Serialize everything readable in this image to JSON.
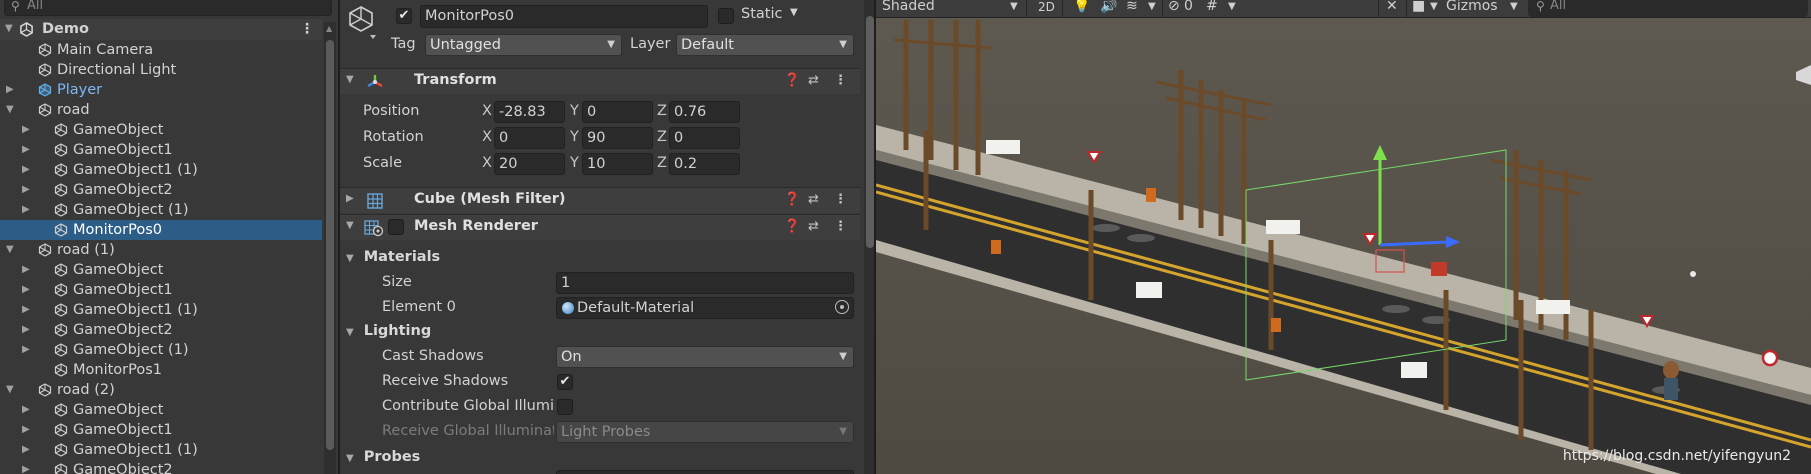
{
  "hierarchy": {
    "search_placeholder": "All",
    "scene_name": "Demo",
    "rows": [
      {
        "label": "Main Camera",
        "indent": 1,
        "arrow": false,
        "kind": "cube"
      },
      {
        "label": "Directional Light",
        "indent": 1,
        "arrow": false,
        "kind": "cube"
      },
      {
        "label": "Player",
        "indent": 1,
        "arrow": true,
        "kind": "prefab"
      },
      {
        "label": "road",
        "indent": 1,
        "arrow": "open",
        "kind": "cube"
      },
      {
        "label": "GameObject",
        "indent": 2,
        "arrow": true,
        "kind": "cube"
      },
      {
        "label": "GameObject1",
        "indent": 2,
        "arrow": true,
        "kind": "cube"
      },
      {
        "label": "GameObject1 (1)",
        "indent": 2,
        "arrow": true,
        "kind": "cube"
      },
      {
        "label": "GameObject2",
        "indent": 2,
        "arrow": true,
        "kind": "cube"
      },
      {
        "label": "GameObject (1)",
        "indent": 2,
        "arrow": true,
        "kind": "cube"
      },
      {
        "label": "MonitorPos0",
        "indent": 2,
        "arrow": false,
        "kind": "cube",
        "selected": true
      },
      {
        "label": "road (1)",
        "indent": 1,
        "arrow": "open",
        "kind": "cube"
      },
      {
        "label": "GameObject",
        "indent": 2,
        "arrow": true,
        "kind": "cube"
      },
      {
        "label": "GameObject1",
        "indent": 2,
        "arrow": true,
        "kind": "cube"
      },
      {
        "label": "GameObject1 (1)",
        "indent": 2,
        "arrow": true,
        "kind": "cube"
      },
      {
        "label": "GameObject2",
        "indent": 2,
        "arrow": true,
        "kind": "cube"
      },
      {
        "label": "GameObject (1)",
        "indent": 2,
        "arrow": true,
        "kind": "cube"
      },
      {
        "label": "MonitorPos1",
        "indent": 2,
        "arrow": false,
        "kind": "cube"
      },
      {
        "label": "road (2)",
        "indent": 1,
        "arrow": "open",
        "kind": "cube"
      },
      {
        "label": "GameObject",
        "indent": 2,
        "arrow": true,
        "kind": "cube"
      },
      {
        "label": "GameObject1",
        "indent": 2,
        "arrow": true,
        "kind": "cube"
      },
      {
        "label": "GameObject1 (1)",
        "indent": 2,
        "arrow": true,
        "kind": "cube"
      },
      {
        "label": "GameObject2",
        "indent": 2,
        "arrow": true,
        "kind": "cube"
      }
    ]
  },
  "inspector": {
    "object_name": "MonitorPos0",
    "static_label": "Static",
    "tag_label": "Tag",
    "tag_value": "Untagged",
    "layer_label": "Layer",
    "layer_value": "Default",
    "transform": {
      "title": "Transform",
      "position_label": "Position",
      "rotation_label": "Rotation",
      "scale_label": "Scale",
      "axis_x": "X",
      "axis_y": "Y",
      "axis_z": "Z",
      "position": {
        "x": "-28.83",
        "y": "0",
        "z": "0.76"
      },
      "rotation": {
        "x": "0",
        "y": "90",
        "z": "0"
      },
      "scale": {
        "x": "20",
        "y": "10",
        "z": "0.2"
      }
    },
    "mesh_filter_title": "Cube (Mesh Filter)",
    "mesh_renderer": {
      "title": "Mesh Renderer",
      "materials_label": "Materials",
      "size_label": "Size",
      "size_value": "1",
      "element0_label": "Element 0",
      "element0_value": "Default-Material",
      "lighting_label": "Lighting",
      "cast_shadows_label": "Cast Shadows",
      "cast_shadows_value": "On",
      "receive_shadows_label": "Receive Shadows",
      "contribute_gi_label": "Contribute Global Illumin",
      "receive_gi_label": "Receive Global Illuminat",
      "receive_gi_value": "Light Probes",
      "probes_label": "Probes"
    }
  },
  "scene_toolbar": {
    "shading_mode": "Shaded",
    "mode_2d": "2D",
    "hidden_count": "0",
    "gizmos_label": "Gizmos",
    "search_placeholder": "All"
  },
  "watermark": "https://blog.csdn.net/yifengyun2",
  "colors": {
    "selection": "#2c5d87",
    "prefab_text": "#7cb8f5",
    "panel_bg": "#383838"
  }
}
